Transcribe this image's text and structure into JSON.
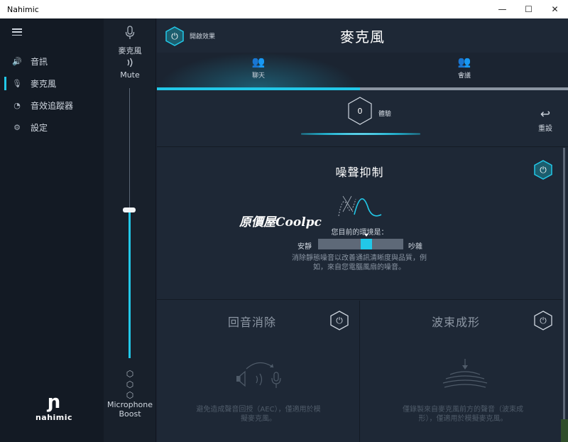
{
  "window": {
    "title": "Nahimic",
    "minimize": "—",
    "maximize": "☐",
    "close": "✕"
  },
  "sidebar": {
    "items": [
      {
        "icon": "speaker-icon",
        "glyph": "🔊",
        "label": "音訊",
        "active": false
      },
      {
        "icon": "microphone-icon",
        "glyph": "🎙",
        "label": "麥克風",
        "active": true
      },
      {
        "icon": "tracker-icon",
        "glyph": "◔",
        "label": "音效追蹤器",
        "active": false
      },
      {
        "icon": "gear-icon",
        "glyph": "⚙",
        "label": "設定",
        "active": false
      }
    ],
    "logo_mark": "ɲ",
    "logo_text": "nahimic"
  },
  "volume": {
    "device_label": "麥克風",
    "mute_label": "Mute",
    "level": 0.55,
    "boost_label_1": "Microphone",
    "boost_label_2": "Boost"
  },
  "header": {
    "effect_toggle_label": "開啟效果",
    "title": "麥克風"
  },
  "tabs": [
    {
      "label": "聊天",
      "active": true
    },
    {
      "label": "會議",
      "active": false
    }
  ],
  "preset": {
    "label": "體驗",
    "reset_label": "重設"
  },
  "noise_suppression": {
    "title": "噪聲抑制",
    "watermark": "原價屋Coolpc",
    "env_label": "您目前的環境是：",
    "quiet_label": "安靜",
    "noisy_label": "吵雜",
    "level": 0.58,
    "description": "消除靜態噪音以改善通訊清晰度與品質，例如，來自您電腦風扇的噪音。"
  },
  "echo_cancellation": {
    "title": "回音消除",
    "description": "避免造成聲音回授（AEC），僅適用於模擬麥克風。"
  },
  "beamforming": {
    "title": "波束成形",
    "description": "僅錄製來自麥克風前方的聲音（波束成形），僅適用於模擬麥克風。"
  },
  "colors": {
    "accent": "#22c8e8",
    "background": "#1e2836",
    "sidebar": "#131a24"
  }
}
